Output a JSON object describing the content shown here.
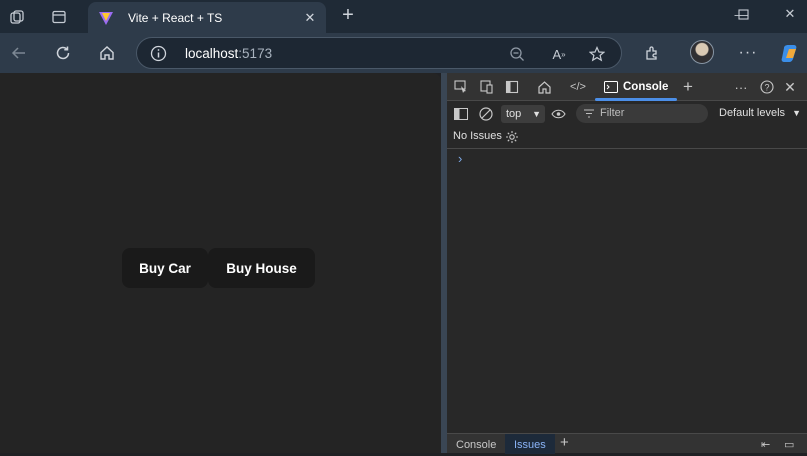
{
  "browser": {
    "tab_title": "Vite + React + TS",
    "url_host": "localhost",
    "url_port": ":5173"
  },
  "page": {
    "buttons": [
      "Buy Car",
      "Buy House"
    ]
  },
  "devtools": {
    "active_tab": "Console",
    "context": "top",
    "filter_placeholder": "Filter",
    "levels": "Default levels",
    "issues_status": "No Issues",
    "prompt_symbol": "›",
    "drawer_tabs": [
      "Console",
      "Issues"
    ],
    "drawer_active": "Issues"
  },
  "colors": {
    "accent": "#4c8fe8",
    "page_bg": "#242424",
    "button_bg": "#1a1a1a"
  }
}
